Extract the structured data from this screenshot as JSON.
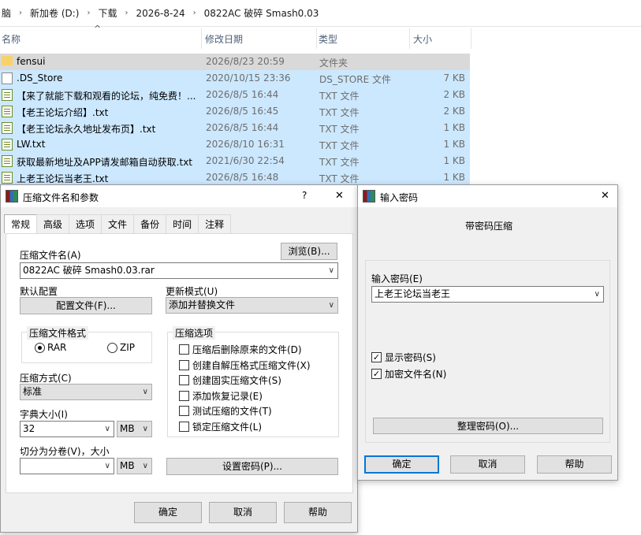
{
  "explorer": {
    "breadcrumb": [
      "脑",
      "新加卷 (D:)",
      "下载",
      "2026-8-24",
      "0822AC 破碎 Smash0.03"
    ],
    "columns": [
      "名称",
      "修改日期",
      "类型",
      "大小"
    ],
    "files": [
      {
        "icon": "folder-icon",
        "name": "fensui",
        "date": "2026/8/23 20:59",
        "type": "文件夹",
        "size": ""
      },
      {
        "icon": "file-icon",
        "name": ".DS_Store",
        "date": "2020/10/15 23:36",
        "type": "DS_STORE 文件",
        "size": "7 KB"
      },
      {
        "icon": "text-file-icon",
        "name": "【来了就能下载和观看的论坛，纯免费！...",
        "date": "2026/8/5 16:44",
        "type": "TXT 文件",
        "size": "2 KB"
      },
      {
        "icon": "text-file-icon",
        "name": "【老王论坛介绍】.txt",
        "date": "2026/8/5 16:45",
        "type": "TXT 文件",
        "size": "2 KB"
      },
      {
        "icon": "text-file-icon",
        "name": "【老王论坛永久地址发布页】.txt",
        "date": "2026/8/5 16:44",
        "type": "TXT 文件",
        "size": "1 KB"
      },
      {
        "icon": "text-file-icon",
        "name": "LW.txt",
        "date": "2026/8/10 16:31",
        "type": "TXT 文件",
        "size": "1 KB"
      },
      {
        "icon": "text-file-icon",
        "name": "获取最新地址及APP请发邮箱自动获取.txt",
        "date": "2021/6/30 22:54",
        "type": "TXT 文件",
        "size": "1 KB"
      },
      {
        "icon": "text-file-icon",
        "name": "上老王论坛当老王.txt",
        "date": "2026/8/5 16:48",
        "type": "TXT 文件",
        "size": "1 KB"
      }
    ]
  },
  "archive_dialog": {
    "title": "压缩文件名和参数",
    "help_glyph": "?",
    "close_glyph": "✕",
    "tabs": [
      "常规",
      "高级",
      "选项",
      "文件",
      "备份",
      "时间",
      "注释"
    ],
    "archive_name_label": "压缩文件名(A)",
    "browse_button": "浏览(B)...",
    "archive_name_value": "0822AC 破碎 Smash0.03.rar",
    "default_profile_label": "默认配置",
    "profiles_button": "配置文件(F)...",
    "update_mode_label": "更新模式(U)",
    "update_mode_value": "添加并替换文件",
    "format_group": "压缩文件格式",
    "format_rar": "RAR",
    "format_zip": "ZIP",
    "options_group": "压缩选项",
    "options": [
      {
        "label": "压缩后删除原来的文件(D)",
        "checked": false
      },
      {
        "label": "创建自解压格式压缩文件(X)",
        "checked": false
      },
      {
        "label": "创建固实压缩文件(S)",
        "checked": false
      },
      {
        "label": "添加恢复记录(E)",
        "checked": false
      },
      {
        "label": "测试压缩的文件(T)",
        "checked": false
      },
      {
        "label": "锁定压缩文件(L)",
        "checked": false
      }
    ],
    "method_label": "压缩方式(C)",
    "method_value": "标准",
    "dict_label": "字典大小(I)",
    "dict_value": "32",
    "dict_unit": "MB",
    "split_label": "切分为分卷(V)，大小",
    "split_value": "",
    "split_unit": "MB",
    "set_password_button": "设置密码(P)...",
    "ok_button": "确定",
    "cancel_button": "取消",
    "help_button": "帮助"
  },
  "password_dialog": {
    "title": "输入密码",
    "close_glyph": "✕",
    "heading": "带密码压缩",
    "password_label": "输入密码(E)",
    "password_value": "上老王论坛当老王",
    "show_password_label": "显示密码(S)",
    "show_password_checked": true,
    "encrypt_names_label": "加密文件名(N)",
    "encrypt_names_checked": true,
    "organize_button": "整理密码(O)...",
    "ok_button": "确定",
    "cancel_button": "取消",
    "help_button": "帮助"
  },
  "colors": {
    "selection": "#cce8ff",
    "dialog_bg": "#f0f0f0",
    "focus_border": "#0078d7"
  }
}
